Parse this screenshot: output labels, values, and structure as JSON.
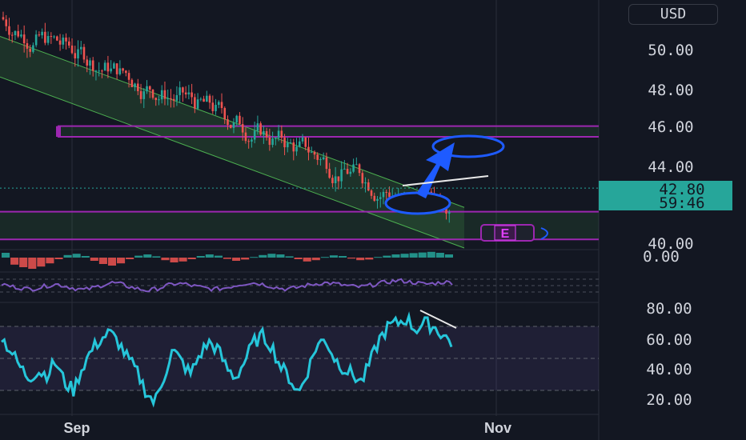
{
  "currency": "USD",
  "last_price": "42.80",
  "countdown": "59:46",
  "event_badge": "E",
  "price_ticks": [
    "50.00",
    "48.00",
    "46.00",
    "44.00",
    "40.00"
  ],
  "macd_tick": "0.00",
  "rsi_ticks": [
    "80.00",
    "60.00",
    "40.00",
    "20.00"
  ],
  "time_labels": [
    "Sep",
    "Nov"
  ],
  "colors": {
    "background": "#131722",
    "up": "#26a69a",
    "down": "#ef5350",
    "channel": "#4caf50",
    "level": "#9c27b0",
    "rsi": "#26c6da",
    "stoch": "#7e57c2",
    "arrow": "#1e5bff",
    "price_tag": "#26a69a"
  },
  "chart_data": [
    {
      "type": "candlestick",
      "y_range": [
        40.0,
        51.6
      ],
      "horizontal_levels": [
        45.7,
        45.2,
        41.7,
        40.4
      ],
      "channel": {
        "upper": [
          [
            0,
            49.9
          ],
          [
            60,
            41.9
          ]
        ],
        "lower": [
          [
            0,
            48.0
          ],
          [
            60,
            40.0
          ]
        ]
      },
      "last_price": 42.8
    },
    {
      "type": "histogram",
      "label": "0.00",
      "values": [
        0.15,
        -0.22,
        -0.3,
        -0.35,
        -0.28,
        -0.18,
        -0.05,
        0.08,
        0.12,
        0.05,
        -0.1,
        -0.2,
        -0.25,
        -0.18,
        -0.05,
        0.06,
        0.1,
        0.04,
        -0.08,
        -0.15,
        -0.12,
        -0.05,
        0.05,
        0.1,
        0.06,
        -0.04,
        -0.1,
        -0.06,
        0.02,
        0.08,
        0.12,
        0.1,
        0.04,
        -0.05,
        -0.12,
        -0.08,
        0.02,
        0.07,
        0.05,
        -0.03,
        -0.08,
        -0.06,
        0.02,
        0.06,
        0.1,
        0.12,
        0.14,
        0.16,
        0.18,
        0.15,
        0.1
      ]
    },
    {
      "type": "line",
      "series": [
        {
          "values": [
            55,
            52,
            50,
            48,
            50,
            53,
            55,
            52,
            49,
            47,
            50,
            54,
            57,
            55,
            51,
            48,
            46,
            49,
            53,
            56,
            55,
            52,
            50,
            48,
            49,
            52,
            55,
            57,
            56,
            53,
            50,
            48,
            50,
            53,
            55,
            57,
            56,
            54,
            52,
            51,
            53,
            56,
            58,
            60,
            59,
            57,
            55,
            56,
            58,
            57
          ]
        }
      ]
    },
    {
      "type": "line",
      "y_range": [
        15,
        85
      ],
      "x_ticks": [
        "Sep",
        "Nov"
      ],
      "y_ticks": [
        80,
        60,
        40,
        20
      ],
      "series": [
        {
          "values": [
            63,
            55,
            45,
            38,
            42,
            40,
            48,
            35,
            30,
            45,
            55,
            62,
            66,
            60,
            50,
            42,
            30,
            22,
            38,
            55,
            48,
            40,
            52,
            60,
            56,
            44,
            38,
            48,
            60,
            64,
            58,
            45,
            38,
            28,
            42,
            58,
            62,
            50,
            44,
            40,
            35,
            48,
            62,
            70,
            72,
            75,
            68,
            72,
            70,
            65,
            60
          ]
        }
      ]
    }
  ]
}
